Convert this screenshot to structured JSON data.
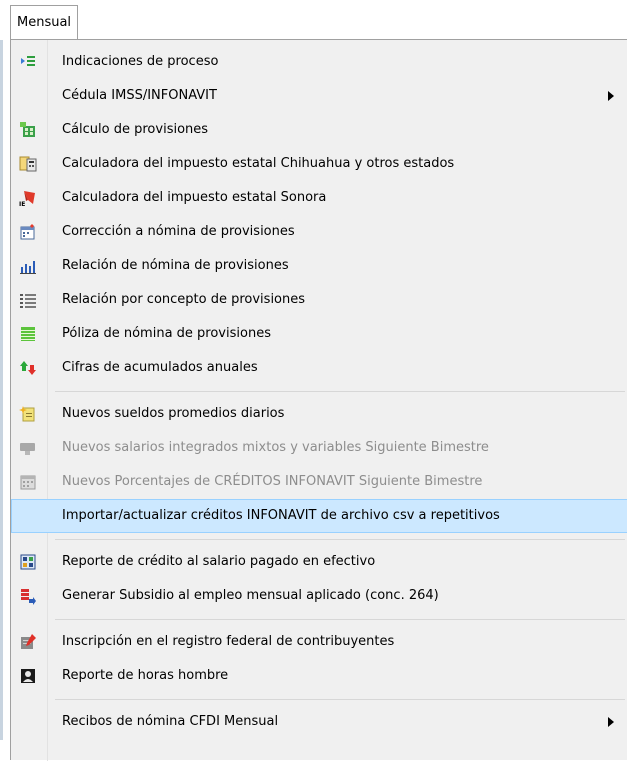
{
  "menubar": {
    "tab_label": "Mensual"
  },
  "menu": {
    "items": [
      {
        "label": "Indicaciones de proceso",
        "icon": "process-list-icon"
      },
      {
        "label": "Cédula IMSS/INFONAVIT",
        "icon": "",
        "submenu": true
      },
      {
        "label": "Cálculo de provisiones",
        "icon": "calculator-green-icon"
      },
      {
        "label": "Calculadora del impuesto estatal Chihuahua y otros estados",
        "icon": "document-calculator-icon"
      },
      {
        "label": "Calculadora del impuesto estatal Sonora",
        "icon": "ie-tax-icon"
      },
      {
        "label": "Corrección a nómina de provisiones",
        "icon": "calendar-edit-icon"
      },
      {
        "label": "Relación de nómina de provisiones",
        "icon": "bar-chart-icon"
      },
      {
        "label": "Relación por concepto de provisiones",
        "icon": "list-icon"
      },
      {
        "label": "Póliza de nómina de provisiones",
        "icon": "green-ledger-icon"
      },
      {
        "label": "Cifras de acumulados anuales",
        "icon": "up-down-arrows-icon"
      },
      {
        "label": "Nuevos sueldos promedios diarios",
        "icon": "sparkle-document-icon"
      },
      {
        "label": "Nuevos salarios integrados mixtos y variables Siguiente Bimestre",
        "icon": "grey-folder-icon",
        "disabled": true
      },
      {
        "label": "Nuevos Porcentajes de CRÉDITOS INFONAVIT Siguiente Bimestre",
        "icon": "grey-calendar-icon",
        "disabled": true
      },
      {
        "label": "Importar/actualizar créditos INFONAVIT de archivo csv a repetitivos",
        "icon": "",
        "highlighted": true
      },
      {
        "label": "Reporte de crédito al salario pagado en efectivo",
        "icon": "report-grid-icon"
      },
      {
        "label": "Generar Subsidio al empleo mensual aplicado (conc. 264)",
        "icon": "subsidy-arrow-icon"
      },
      {
        "label": "Inscripción en el registro federal de contribuyentes",
        "icon": "registration-pen-icon"
      },
      {
        "label": "Reporte de horas hombre",
        "icon": "person-report-icon"
      },
      {
        "label": "Recibos de nómina CFDI Mensual",
        "icon": "",
        "submenu": true
      }
    ]
  },
  "colors": {
    "highlight_bg": "#cce8ff",
    "highlight_border": "#99d1ff",
    "menu_bg": "#f0f0f0",
    "disabled_text": "#8d8d8d"
  }
}
